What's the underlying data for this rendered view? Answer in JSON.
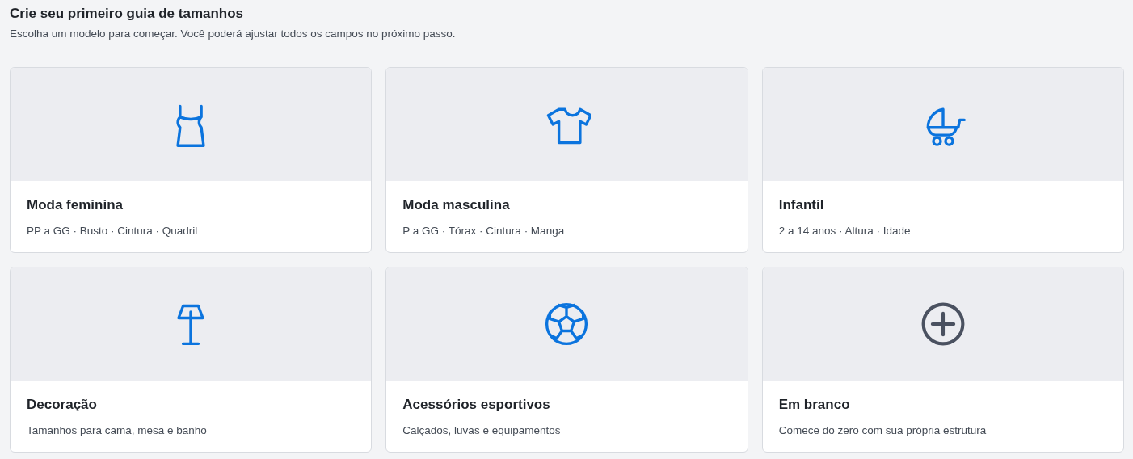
{
  "header": {
    "title": "Crie seu primeiro guia de tamanhos",
    "subtitle": "Escolha um modelo para começar. Você poderá ajustar todos os campos no próximo passo."
  },
  "templates": [
    {
      "kind": "tank-top",
      "title": "Moda feminina",
      "description": "PP a GG · Busto · Cintura · Quadril"
    },
    {
      "kind": "t-shirt",
      "title": "Moda masculina",
      "description": "P a GG · Tórax · Cintura · Manga"
    },
    {
      "kind": "stroller",
      "title": "Infantil",
      "description": "2 a 14 anos · Altura · Idade"
    },
    {
      "kind": "lamp",
      "title": "Decoração",
      "description": "Tamanhos para cama, mesa e banho"
    },
    {
      "kind": "ball",
      "title": "Acessórios esportivos",
      "description": "Calçados, luvas e equipamentos"
    },
    {
      "kind": "blank",
      "title": "Em branco",
      "description": "Comece do zero com sua própria estrutura"
    }
  ]
}
